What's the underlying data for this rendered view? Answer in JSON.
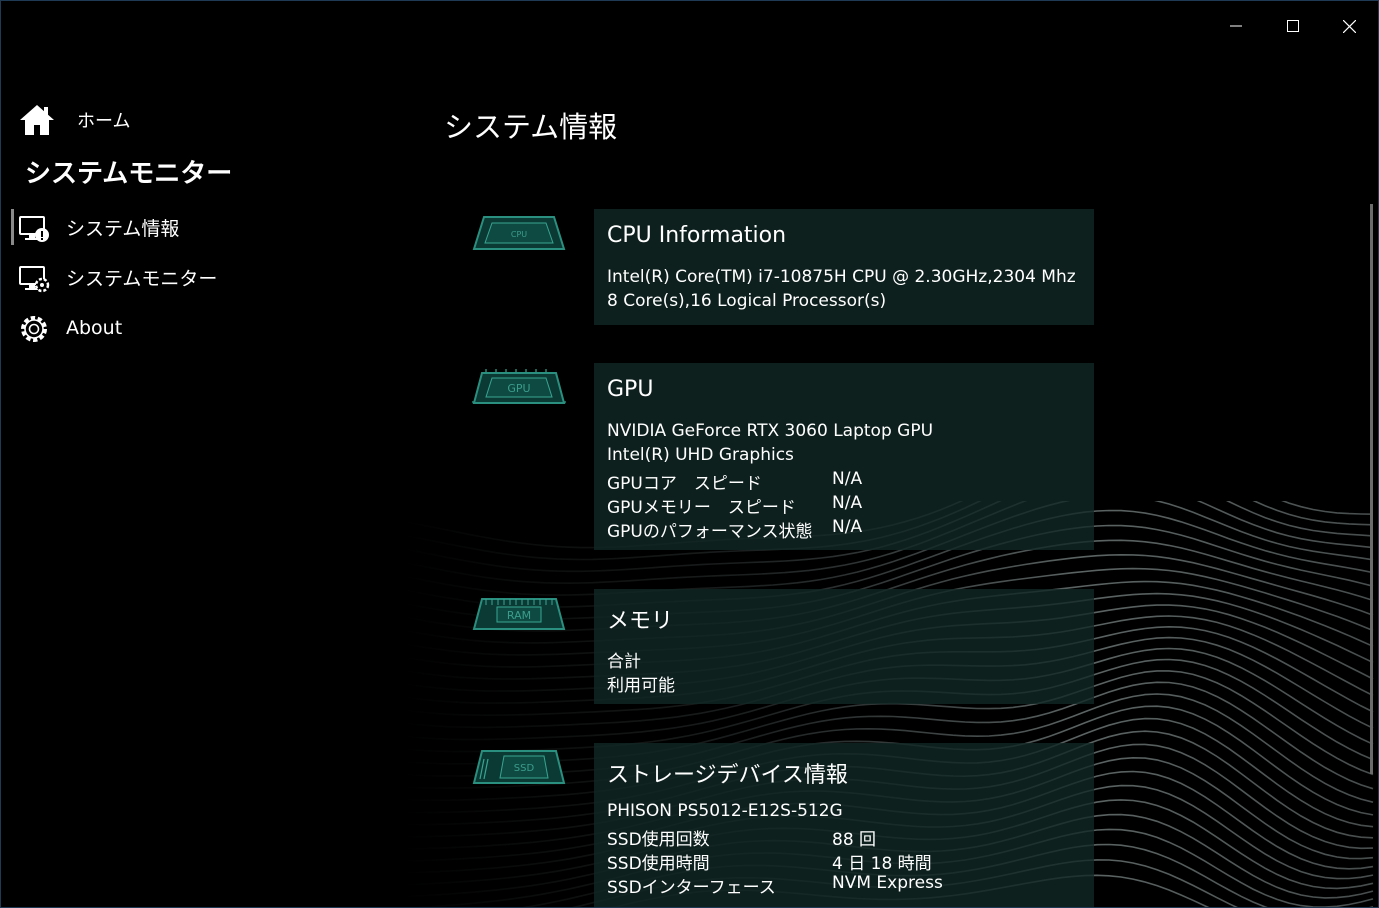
{
  "window": {
    "minimize_icon": "minimize-icon",
    "maximize_icon": "maximize-icon",
    "close_icon": "close-icon"
  },
  "sidebar": {
    "home_label": "ホーム",
    "app_title": "システムモニター",
    "items": [
      {
        "label": "システム情報",
        "icon": "system-info-icon",
        "selected": true
      },
      {
        "label": "システムモニター",
        "icon": "system-monitor-icon",
        "selected": false
      },
      {
        "label": "About",
        "icon": "gear-icon",
        "selected": false
      }
    ]
  },
  "main": {
    "page_title": "システム情報",
    "cpu": {
      "chip_label": "CPU",
      "title": "CPU Information",
      "lines": [
        "Intel(R) Core(TM) i7-10875H CPU @ 2.30GHz,2304 Mhz",
        "8 Core(s),16 Logical Processor(s)"
      ]
    },
    "gpu": {
      "chip_label": "GPU",
      "title": "GPU",
      "lines": [
        "NVIDIA GeForce RTX 3060 Laptop GPU",
        "Intel(R) UHD Graphics"
      ],
      "rows": [
        {
          "label": "GPUコア　スピード",
          "value": "N/A"
        },
        {
          "label": "GPUメモリー　スピード",
          "value": "N/A"
        },
        {
          "label": "GPUのパフォーマンス状態",
          "value": "N/A"
        }
      ]
    },
    "memory": {
      "chip_label": "RAM",
      "title": "メモリ",
      "lines": [
        "合計",
        "利用可能"
      ]
    },
    "storage": {
      "chip_label": "SSD",
      "title": "ストレージデバイス情報",
      "lines": [
        "PHISON PS5012-E12S-512G"
      ],
      "rows": [
        {
          "label": "SSD使用回数",
          "value": "88 回"
        },
        {
          "label": "SSD使用時間",
          "value": "4 日 18 時間"
        },
        {
          "label": "SSDインターフェース",
          "value": "NVM Express"
        }
      ]
    }
  },
  "colors": {
    "accent": "#1f8a78",
    "card_bg": "#0f2624",
    "background": "#000000"
  }
}
